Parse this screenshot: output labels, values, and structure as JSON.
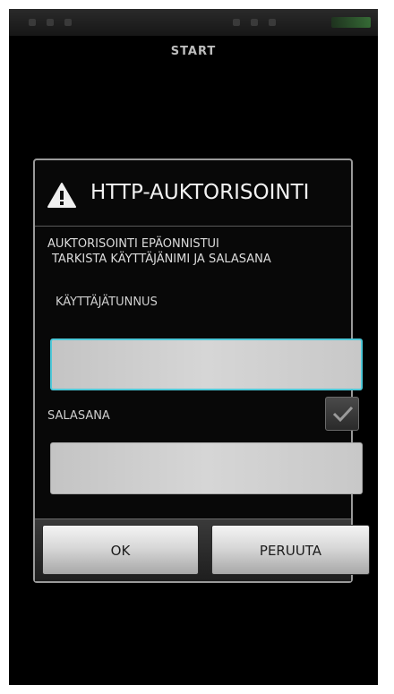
{
  "app_title": "START",
  "dialog": {
    "title": "HTTP-AUKTORISOINTI",
    "icon": "warning-icon",
    "message_line1": "AUKTORISOINTI EPÄONNISTUI",
    "message_line2": "TARKISTA KÄYTTÄJÄNIMI JA SALASANA",
    "username_label": "KÄYTTÄJÄTUNNUS",
    "username_value": "",
    "password_label": "SALASANA",
    "password_value": "",
    "show_password_checked": true,
    "ok_label": "OK",
    "cancel_label": "PERUUTA"
  },
  "colors": {
    "focus_border": "#4ec8d8",
    "background": "#000000"
  }
}
